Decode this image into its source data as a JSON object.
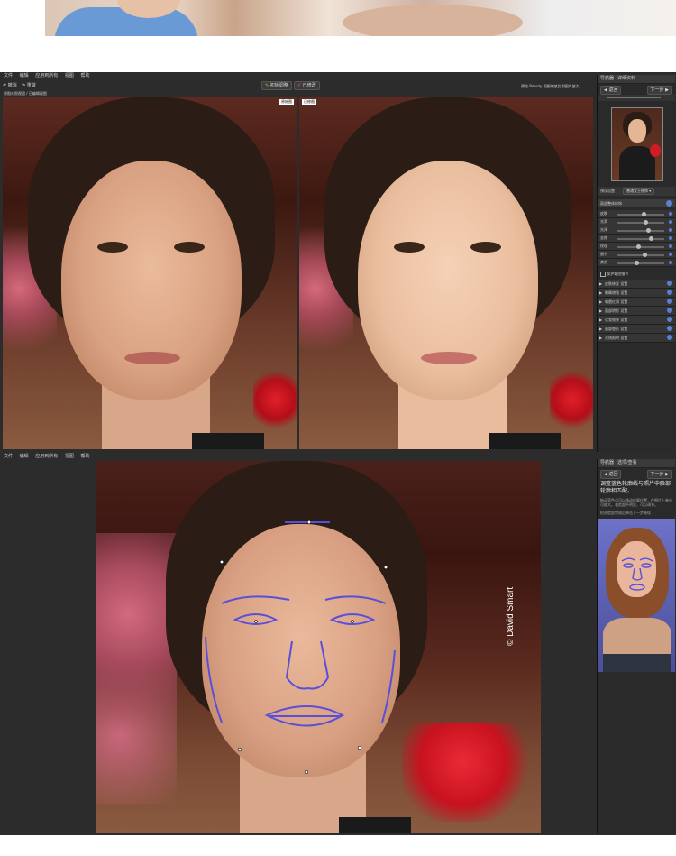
{
  "top_app": {
    "menu": [
      "文件",
      "编辑",
      "应用到所有",
      "视图",
      "帮助"
    ],
    "undo_label": "撤消",
    "redo_label": "重做",
    "mode_buttons": [
      "初始调整",
      "已修改"
    ],
    "zoom_text": "预览 Beauty 视图缩放比例图片放大",
    "breadcrumb": "原图对照视图 / 已编辑视图",
    "before_tag": "原始图",
    "after_tag": "已修图",
    "panel_tabs": [
      "导航器",
      "详细资料"
    ],
    "nav_prev": "返回",
    "nav_next": "下一步",
    "preset_label": "预设设置",
    "preset_value": "普通女士修饰",
    "group_title": "面部整体修饰",
    "sliders": [
      {
        "name": "皮肤",
        "value": 0.55
      },
      {
        "name": "光滑",
        "value": 0.6
      },
      {
        "name": "光泽",
        "value": 0.65
      },
      {
        "name": "去除",
        "value": 0.72
      },
      {
        "name": "纹理",
        "value": 0.45
      },
      {
        "name": "细节",
        "value": 0.58
      },
      {
        "name": "其他",
        "value": 0.4
      }
    ],
    "checkbox_label": "保护皱纹细节",
    "sections": [
      "皮肤修复 设置",
      "眼睛增强 设置",
      "嘴唇红润 设置",
      "面部阴影 设置",
      "化妆效果 设置",
      "面部塑形 设置",
      "光线照明 设置"
    ]
  },
  "bottom_app": {
    "menu": [
      "文件",
      "编辑",
      "应用到所有",
      "视图",
      "帮助"
    ],
    "panel_tabs": [
      "导航器",
      "选项/查看"
    ],
    "nav_prev": "返回",
    "nav_next": "下一步",
    "heading": "调整蓝色轮廓线与照片中脸部轮廓相匹配。",
    "hint1": "拖动蓝色点可以移动轮廓位置，在图片上单击可放大。若脸部不明显，可以调节。",
    "hint2": "检测脸部完成后单击下一步继续",
    "watermark": "© David Smart"
  },
  "colors": {
    "outline": "#5a4fd8",
    "panel": "#2c2c2c",
    "accent": "#5b7fd1"
  }
}
